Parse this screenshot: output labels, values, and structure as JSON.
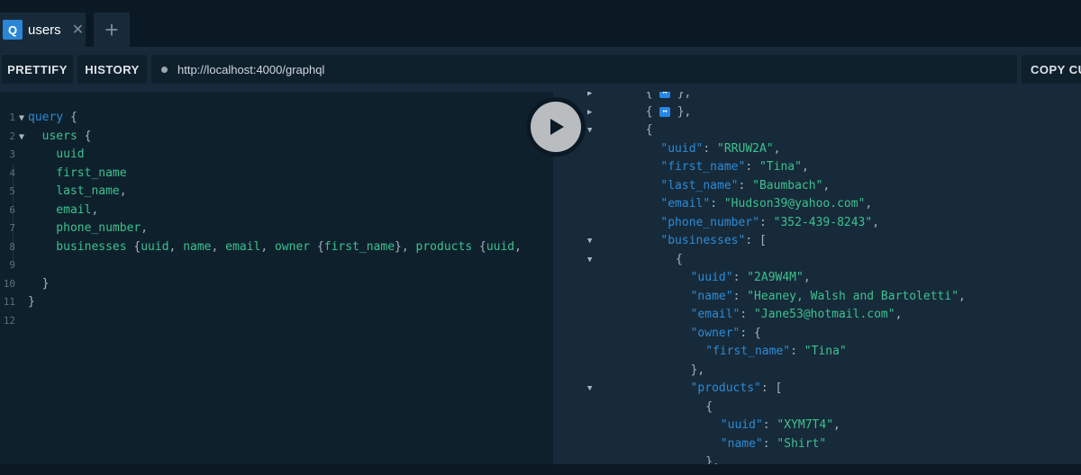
{
  "tabs": [
    {
      "icon_letter": "Q",
      "title": "users",
      "close_glyph": "✕"
    }
  ],
  "add_tab_glyph": "+",
  "toolbar": {
    "prettify": "PRETTIFY",
    "history": "HISTORY",
    "url": "http://localhost:4000/graphql",
    "copy": "COPY CU"
  },
  "play_icon": "play-icon",
  "query_lines": [
    {
      "num": "1",
      "fold": true,
      "parts": [
        [
          "kw",
          "query"
        ],
        [
          "op",
          " {"
        ]
      ]
    },
    {
      "num": "2",
      "fold": true,
      "parts": [
        [
          "fld",
          "  users"
        ],
        [
          "op",
          " {"
        ]
      ]
    },
    {
      "num": "3",
      "fold": false,
      "parts": [
        [
          "fld",
          "    uuid"
        ]
      ]
    },
    {
      "num": "4",
      "fold": false,
      "parts": [
        [
          "fld",
          "    first_name"
        ]
      ]
    },
    {
      "num": "5",
      "fold": false,
      "parts": [
        [
          "fld",
          "    last_name"
        ],
        [
          "op",
          ","
        ]
      ]
    },
    {
      "num": "6",
      "fold": false,
      "parts": [
        [
          "fld",
          "    email"
        ],
        [
          "op",
          ","
        ]
      ]
    },
    {
      "num": "7",
      "fold": false,
      "parts": [
        [
          "fld",
          "    phone_number"
        ],
        [
          "op",
          ","
        ]
      ]
    },
    {
      "num": "8",
      "fold": false,
      "parts": [
        [
          "fld",
          "    businesses "
        ],
        [
          "op",
          "{"
        ],
        [
          "fld",
          "uuid"
        ],
        [
          "op",
          ", "
        ],
        [
          "fld",
          "name"
        ],
        [
          "op",
          ", "
        ],
        [
          "fld",
          "email"
        ],
        [
          "op",
          ", "
        ],
        [
          "fld",
          "owner "
        ],
        [
          "op",
          "{"
        ],
        [
          "fld",
          "first_name"
        ],
        [
          "op",
          "}, "
        ],
        [
          "fld",
          "products "
        ],
        [
          "op",
          "{"
        ],
        [
          "fld",
          "uuid"
        ],
        [
          "op",
          ","
        ]
      ]
    },
    {
      "num": "9",
      "fold": false,
      "parts": []
    },
    {
      "num": "10",
      "fold": false,
      "parts": [
        [
          "op",
          "  }"
        ]
      ]
    },
    {
      "num": "11",
      "fold": false,
      "parts": [
        [
          "op",
          "}"
        ]
      ]
    },
    {
      "num": "12",
      "fold": false,
      "parts": []
    }
  ],
  "result_lines": [
    {
      "fold": "right",
      "indent": 6,
      "parts": [
        [
          "op",
          "{ "
        ],
        [
          "badge",
          "↔"
        ],
        [
          "op",
          " },"
        ]
      ]
    },
    {
      "fold": "right",
      "indent": 6,
      "parts": [
        [
          "op",
          "{ "
        ],
        [
          "badge",
          "↔"
        ],
        [
          "op",
          " },"
        ]
      ]
    },
    {
      "fold": "down",
      "indent": 6,
      "parts": [
        [
          "op",
          "{"
        ]
      ]
    },
    {
      "fold": "",
      "indent": 8,
      "parts": [
        [
          "key",
          "\"uuid\""
        ],
        [
          "op",
          ": "
        ],
        [
          "str",
          "\"RRUW2A\""
        ],
        [
          "op",
          ","
        ]
      ]
    },
    {
      "fold": "",
      "indent": 8,
      "parts": [
        [
          "key",
          "\"first_name\""
        ],
        [
          "op",
          ": "
        ],
        [
          "str",
          "\"Tina\""
        ],
        [
          "op",
          ","
        ]
      ]
    },
    {
      "fold": "",
      "indent": 8,
      "parts": [
        [
          "key",
          "\"last_name\""
        ],
        [
          "op",
          ": "
        ],
        [
          "str",
          "\"Baumbach\""
        ],
        [
          "op",
          ","
        ]
      ]
    },
    {
      "fold": "",
      "indent": 8,
      "parts": [
        [
          "key",
          "\"email\""
        ],
        [
          "op",
          ": "
        ],
        [
          "str",
          "\"Hudson39@yahoo.com\""
        ],
        [
          "op",
          ","
        ]
      ]
    },
    {
      "fold": "",
      "indent": 8,
      "parts": [
        [
          "key",
          "\"phone_number\""
        ],
        [
          "op",
          ": "
        ],
        [
          "str",
          "\"352-439-8243\""
        ],
        [
          "op",
          ","
        ]
      ]
    },
    {
      "fold": "down",
      "indent": 8,
      "parts": [
        [
          "key",
          "\"businesses\""
        ],
        [
          "op",
          ": ["
        ]
      ]
    },
    {
      "fold": "down",
      "indent": 10,
      "parts": [
        [
          "op",
          "{"
        ]
      ]
    },
    {
      "fold": "",
      "indent": 12,
      "parts": [
        [
          "key",
          "\"uuid\""
        ],
        [
          "op",
          ": "
        ],
        [
          "str",
          "\"2A9W4M\""
        ],
        [
          "op",
          ","
        ]
      ]
    },
    {
      "fold": "",
      "indent": 12,
      "parts": [
        [
          "key",
          "\"name\""
        ],
        [
          "op",
          ": "
        ],
        [
          "str",
          "\"Heaney, Walsh and Bartoletti\""
        ],
        [
          "op",
          ","
        ]
      ]
    },
    {
      "fold": "",
      "indent": 12,
      "parts": [
        [
          "key",
          "\"email\""
        ],
        [
          "op",
          ": "
        ],
        [
          "str",
          "\"Jane53@hotmail.com\""
        ],
        [
          "op",
          ","
        ]
      ]
    },
    {
      "fold": "",
      "indent": 12,
      "parts": [
        [
          "key",
          "\"owner\""
        ],
        [
          "op",
          ": {"
        ]
      ]
    },
    {
      "fold": "",
      "indent": 14,
      "parts": [
        [
          "key",
          "\"first_name\""
        ],
        [
          "op",
          ": "
        ],
        [
          "str",
          "\"Tina\""
        ]
      ]
    },
    {
      "fold": "",
      "indent": 12,
      "parts": [
        [
          "op",
          "},"
        ]
      ]
    },
    {
      "fold": "down",
      "indent": 12,
      "parts": [
        [
          "key",
          "\"products\""
        ],
        [
          "op",
          ": ["
        ]
      ]
    },
    {
      "fold": "",
      "indent": 14,
      "parts": [
        [
          "op",
          "{"
        ]
      ]
    },
    {
      "fold": "",
      "indent": 16,
      "parts": [
        [
          "key",
          "\"uuid\""
        ],
        [
          "op",
          ": "
        ],
        [
          "str",
          "\"XYM7T4\""
        ],
        [
          "op",
          ","
        ]
      ]
    },
    {
      "fold": "",
      "indent": 16,
      "parts": [
        [
          "key",
          "\"name\""
        ],
        [
          "op",
          ": "
        ],
        [
          "str",
          "\"Shirt\""
        ]
      ]
    },
    {
      "fold": "",
      "indent": 14,
      "parts": [
        [
          "op",
          "},"
        ]
      ]
    }
  ]
}
